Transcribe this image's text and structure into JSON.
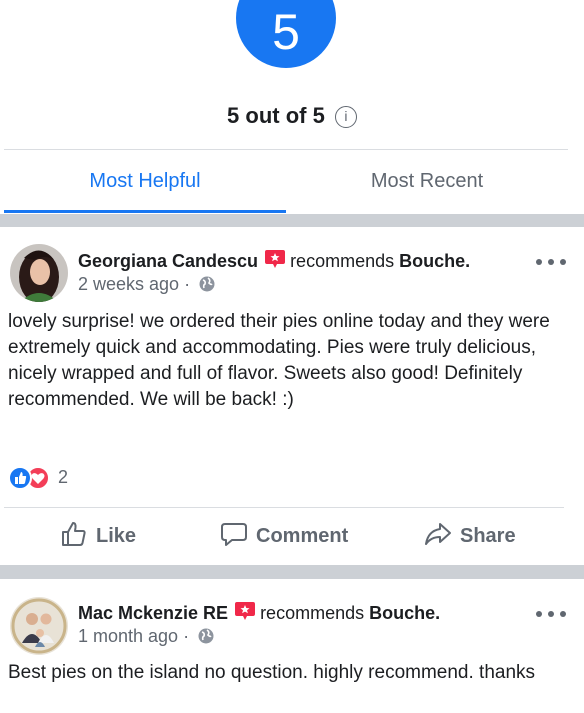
{
  "rating": {
    "value": "5",
    "summary": "5 out of 5",
    "info_symbol": "i"
  },
  "tabs": [
    {
      "label": "Most Helpful",
      "active": true
    },
    {
      "label": "Most Recent",
      "active": false
    }
  ],
  "colors": {
    "accent": "#1877f2",
    "recommend_badge": "#f02849",
    "love": "#f33e58",
    "secondary_text": "#606770",
    "divider_band": "#ccd0d5"
  },
  "posts": [
    {
      "author": "Georgiana Candescu",
      "action_text": "recommends",
      "page": "Bouche.",
      "time": "2 weeks ago ·",
      "privacy_icon": "globe-icon",
      "body": "lovely surprise! we ordered their pies online today and they were extremely quick and accommodating. Pies were truly delicious, nicely wrapped and full of flavor. Sweets also good! Definitely recommended. We will be back! :)",
      "reaction_count": "2"
    },
    {
      "author": "Mac Mckenzie RE",
      "action_text": "recommends",
      "page": "Bouche.",
      "time": "1 month ago ·",
      "privacy_icon": "globe-icon",
      "body": "Best pies on the island no question. highly recommend. thanks"
    }
  ],
  "actions": {
    "like": "Like",
    "comment": "Comment",
    "share": "Share"
  }
}
